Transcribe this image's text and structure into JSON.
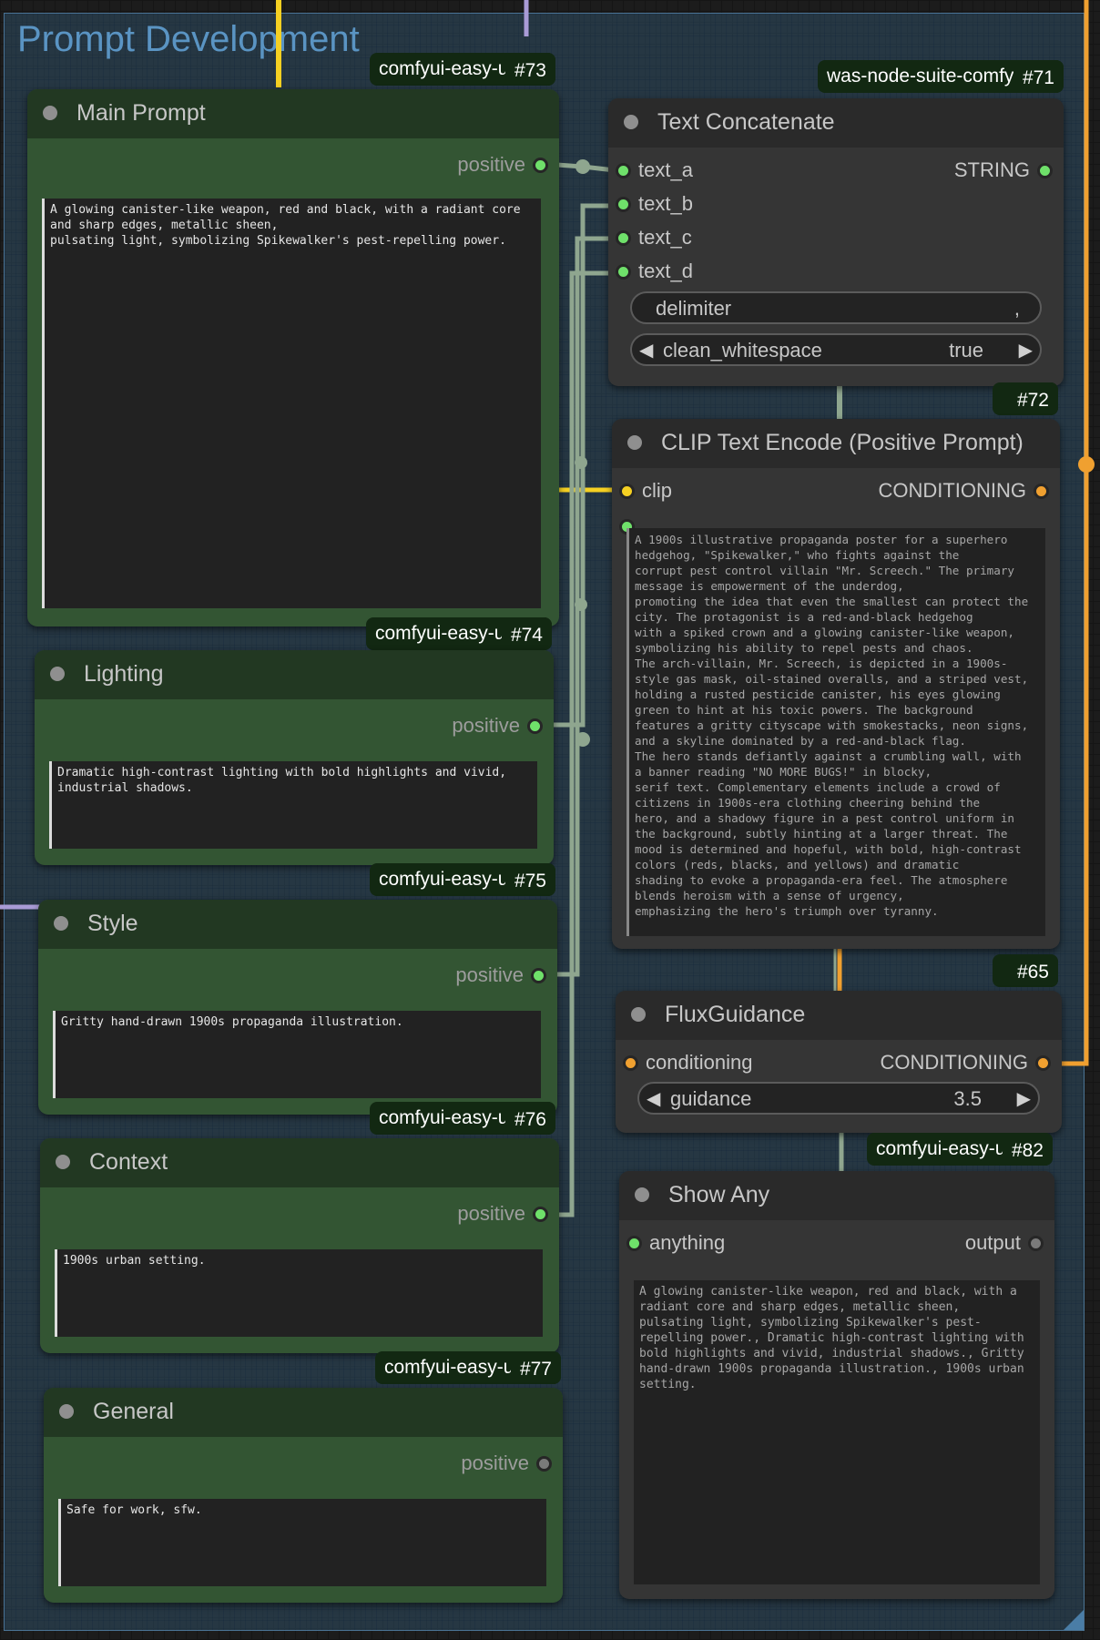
{
  "group": {
    "title": "Prompt Development"
  },
  "colors": {
    "green_node": "#335533",
    "gray_node": "#353535",
    "group_bg": "#345c7a",
    "slot_green": "#6fe06a",
    "slot_orange": "#f0a030",
    "slot_yellow": "#f5d022",
    "wire_yellow": "#f5d022",
    "wire_purple": "#a99bd6",
    "wire_gray": "#8fa68f",
    "wire_orange": "#f0a030"
  },
  "nodes": {
    "main_prompt": {
      "badge_name": "comfyui-easy-use",
      "badge_id": "#73",
      "title": "Main Prompt",
      "output": "positive",
      "text": "A glowing canister-like weapon, red and black, with a radiant core\nand sharp edges, metallic sheen,\npulsating light, symbolizing Spikewalker's pest-repelling power."
    },
    "lighting": {
      "badge_name": "comfyui-easy-use",
      "badge_id": "#74",
      "title": "Lighting",
      "output": "positive",
      "text": "Dramatic high-contrast lighting with bold highlights and vivid,\nindustrial shadows."
    },
    "style": {
      "badge_name": "comfyui-easy-use",
      "badge_id": "#75",
      "title": "Style",
      "output": "positive",
      "text": "Gritty hand-drawn 1900s propaganda illustration."
    },
    "context": {
      "badge_name": "comfyui-easy-use",
      "badge_id": "#76",
      "title": "Context",
      "output": "positive",
      "text": "1900s urban setting."
    },
    "general": {
      "badge_name": "comfyui-easy-use",
      "badge_id": "#77",
      "title": "General",
      "output": "positive",
      "text": "Safe for work, sfw."
    },
    "text_concatenate": {
      "badge_name": "was-node-suite-comfyui",
      "badge_id": "#71",
      "title": "Text Concatenate",
      "inputs": [
        "text_a",
        "text_b",
        "text_c",
        "text_d"
      ],
      "output": "STRING",
      "delimiter_label": "delimiter",
      "delimiter_value": ",",
      "clean_whitespace_label": "clean_whitespace",
      "clean_whitespace_value": "true"
    },
    "clip_text_encode": {
      "badge_id": "#72",
      "title": "CLIP Text Encode (Positive Prompt)",
      "input": "clip",
      "output": "CONDITIONING",
      "text": "A 1900s illustrative propaganda poster for a superhero\nhedgehog, \"Spikewalker,\" who fights against the\ncorrupt pest control villain \"Mr. Screech.\" The primary\nmessage is empowerment of the underdog,\npromoting the idea that even the smallest can protect the\ncity. The protagonist is a red-and-black hedgehog\nwith a spiked crown and a glowing canister-like weapon,\nsymbolizing his ability to repel pests and chaos.\nThe arch-villain, Mr. Screech, is depicted in a 1900s-\nstyle gas mask, oil-stained overalls, and a striped vest,\nholding a rusted pesticide canister, his eyes glowing\ngreen to hint at his toxic powers. The background\nfeatures a gritty cityscape with smokestacks, neon signs,\nand a skyline dominated by a red-and-black flag.\nThe hero stands defiantly against a crumbling wall, with\na banner reading \"NO MORE BUGS!\" in blocky,\nserif text. Complementary elements include a crowd of\ncitizens in 1900s-era clothing cheering behind the\nhero, and a shadowy figure in a pest control uniform in\nthe background, subtly hinting at a larger threat. The\nmood is determined and hopeful, with bold, high-contrast\ncolors (reds, blacks, and yellows) and dramatic\nshading to evoke a propaganda-era feel. The atmosphere\nblends heroism with a sense of urgency,\nemphasizing the hero's triumph over tyranny."
    },
    "flux_guidance": {
      "badge_id": "#65",
      "title": "FluxGuidance",
      "input": "conditioning",
      "output": "CONDITIONING",
      "guidance_label": "guidance",
      "guidance_value": "3.5"
    },
    "show_any": {
      "badge_name": "comfyui-easy-use",
      "badge_id": "#82",
      "title": "Show Any",
      "input": "anything",
      "output": "output",
      "text": "A glowing canister-like weapon, red and black, with a\nradiant core and sharp edges, metallic sheen,\npulsating light, symbolizing Spikewalker's pest-\nrepelling power., Dramatic high-contrast lighting with\nbold highlights and vivid, industrial shadows., Gritty\nhand-drawn 1900s propaganda illustration., 1900s urban\nsetting."
    }
  }
}
